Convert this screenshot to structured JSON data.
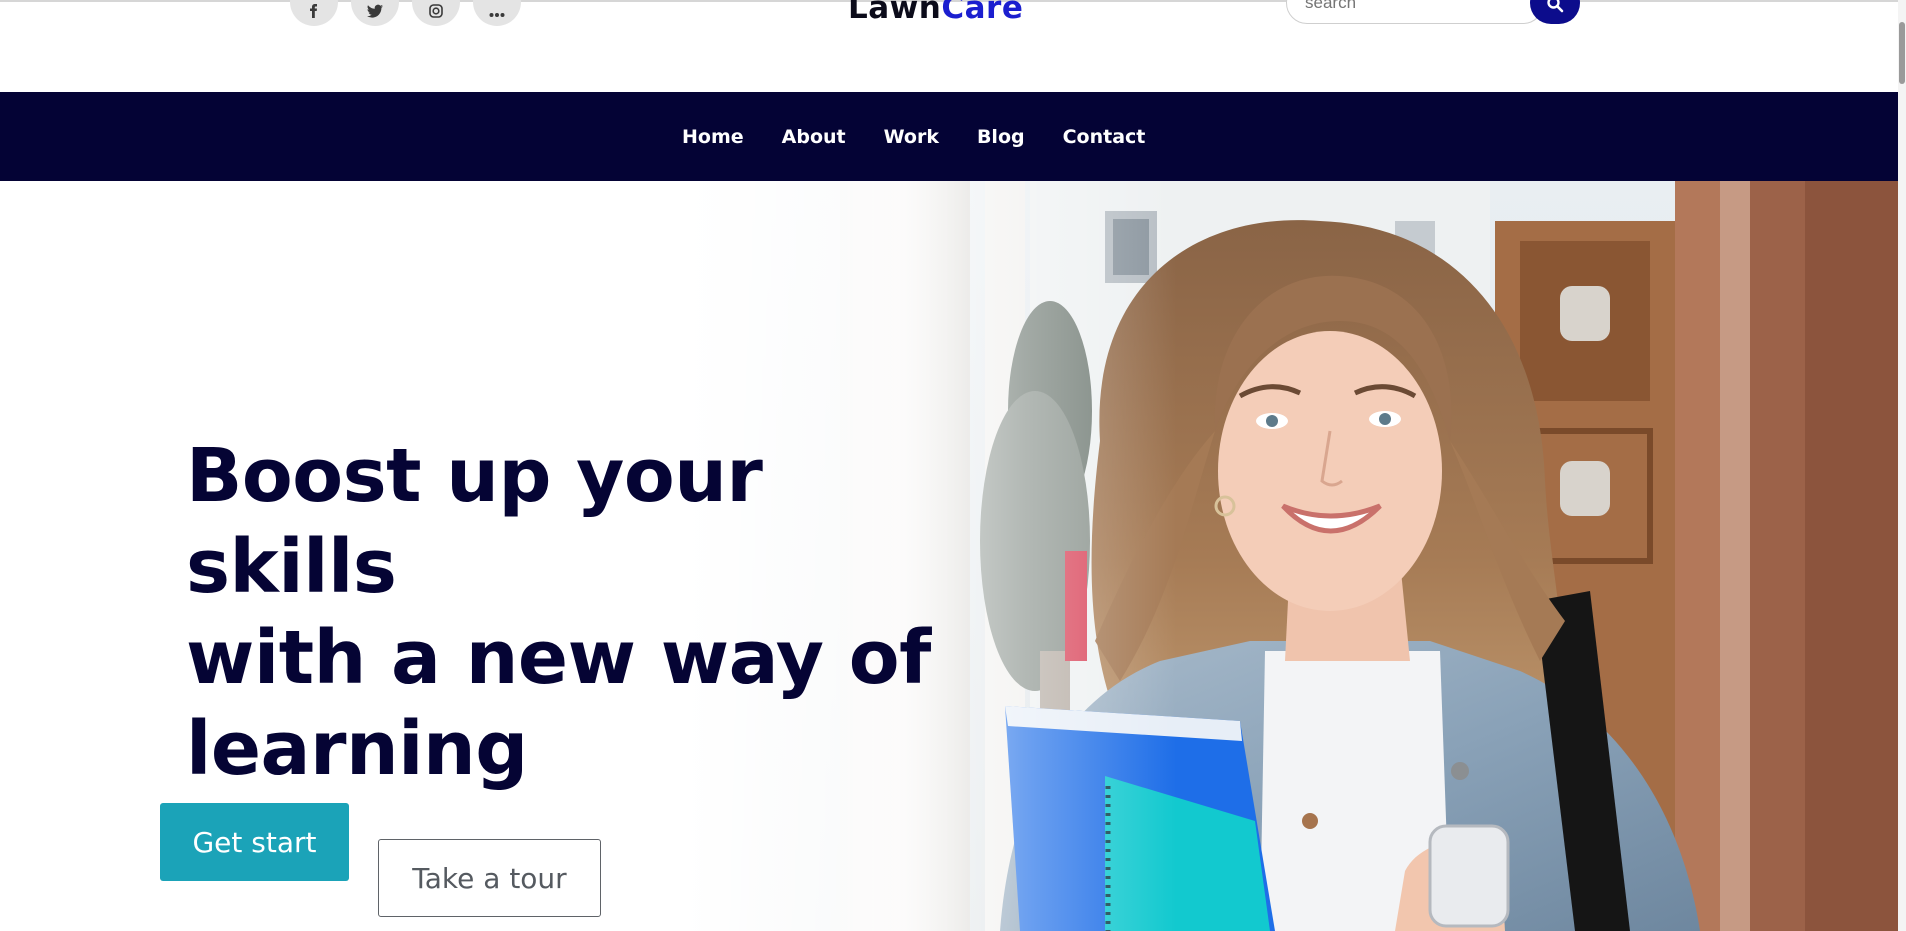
{
  "header": {
    "logo": {
      "part1": "Lawn",
      "part2": "Care"
    },
    "social_icons": [
      "facebook-icon",
      "twitter-icon",
      "instagram-icon",
      "more-icon"
    ],
    "search": {
      "placeholder": "search",
      "icon": "search-icon"
    }
  },
  "nav": {
    "items": [
      {
        "label": "Home"
      },
      {
        "label": "About"
      },
      {
        "label": "Work"
      },
      {
        "label": "Blog"
      },
      {
        "label": "Contact"
      }
    ]
  },
  "hero": {
    "headline_lines": [
      "Boost up your skills",
      "with a new way of",
      "learning"
    ],
    "primary_button": "Get start",
    "secondary_button": "Take a tour",
    "image": "student-photo"
  },
  "colors": {
    "nav_background": "#040335",
    "headline": "#050434",
    "logo_accent": "#1b1fcf",
    "search_button": "#0c0c8c",
    "primary_button": "#1ba3b8"
  }
}
